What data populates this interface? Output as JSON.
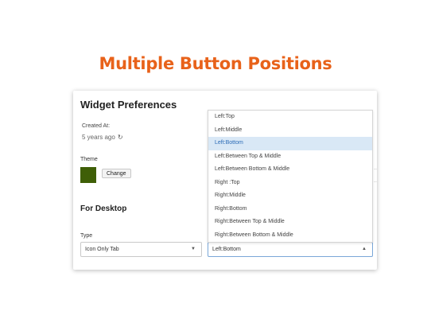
{
  "slide": {
    "title": "Multiple Button Positions"
  },
  "card": {
    "title": "Widget Preferences",
    "created_label": "Created At:",
    "created_value": "5 years ago",
    "refresh_icon": "refresh-icon",
    "theme_label": "Theme",
    "theme_color": "#3f5f07",
    "change_label": "Change",
    "section_title": "For Desktop",
    "type_label": "Type",
    "type_value": "Icon Only Tab",
    "position_value": "Left:Bottom"
  },
  "dropdown": {
    "selected": "Left:Bottom",
    "options": [
      "Left:Top",
      "Left:Middle",
      "Left:Bottom",
      "Left:Between Top & Middle",
      "Left:Between Bottom & Middle",
      "Right :Top",
      "Right:Middle",
      "Right:Bottom",
      "Right:Between Top & Middle",
      "Right:Between Bottom & Middle"
    ]
  },
  "colors": {
    "accent": "#e8621a",
    "highlight": "#d9e8f6",
    "selected_text": "#2b6bb6"
  }
}
